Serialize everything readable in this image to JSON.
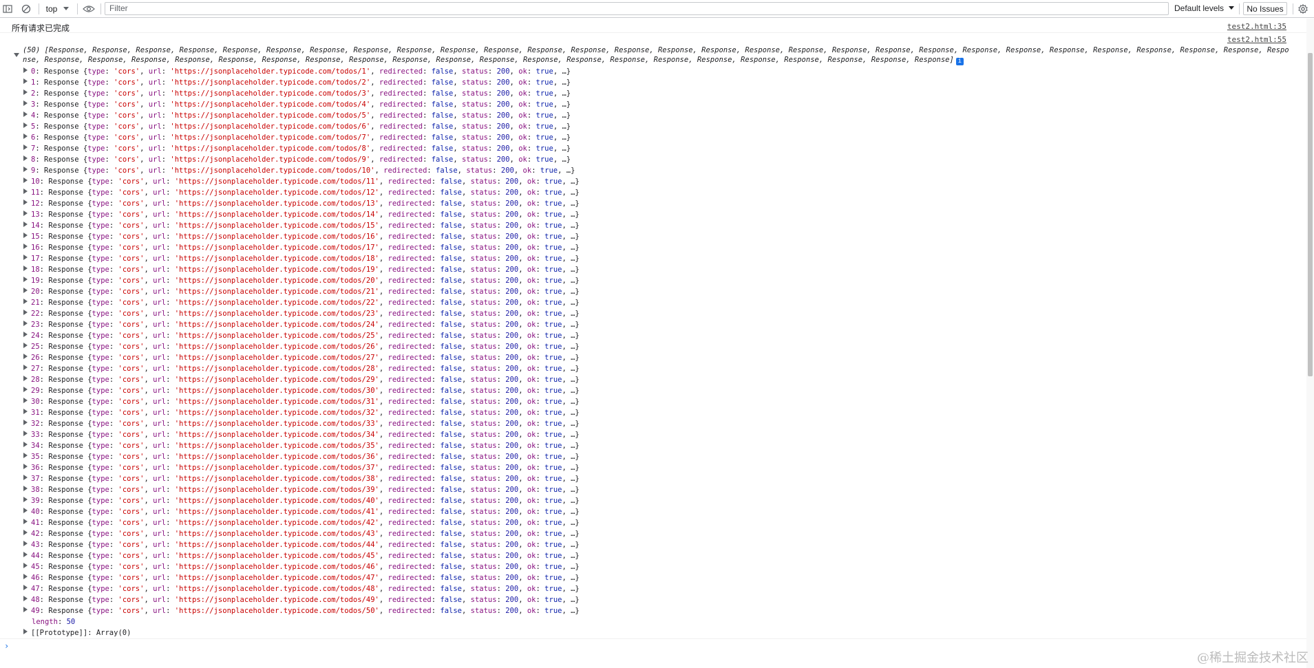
{
  "toolbar": {
    "context": "top",
    "filter_placeholder": "Filter",
    "levels": "Default levels",
    "issues": "No Issues"
  },
  "messages": [
    {
      "text": "所有请求已完成",
      "source": "test2.html:35"
    },
    {
      "source": "test2.html:55"
    }
  ],
  "array_summary": {
    "count": "(50)",
    "text": "[Response, Response, Response, Response, Response, Response, Response, Response, Response, Response, Response, Response, Response, Response, Response, Response, Response, Response, Response, Response, Response, Response, Response, Response, Response, Response, Response, Response, Response, Response, Response, Response, Response, Response, Response, Response, Response, Response, Response, Response, Response, Response, Response, Response, Response, Response, Response, Response, Response, Response]",
    "info": "i"
  },
  "response_item": {
    "name": "Response",
    "type": "'cors'",
    "url_prefix": "'https://jsonplaceholder.typicode.com/todos/",
    "redirected": "false",
    "status": "200",
    "ok": "true",
    "suffix": ", …}"
  },
  "item_count": 50,
  "length_label": "length",
  "length_value": "50",
  "prototype_label": "[[Prototype]]",
  "prototype_value": "Array(0)",
  "watermark": "@稀土掘金技术社区"
}
